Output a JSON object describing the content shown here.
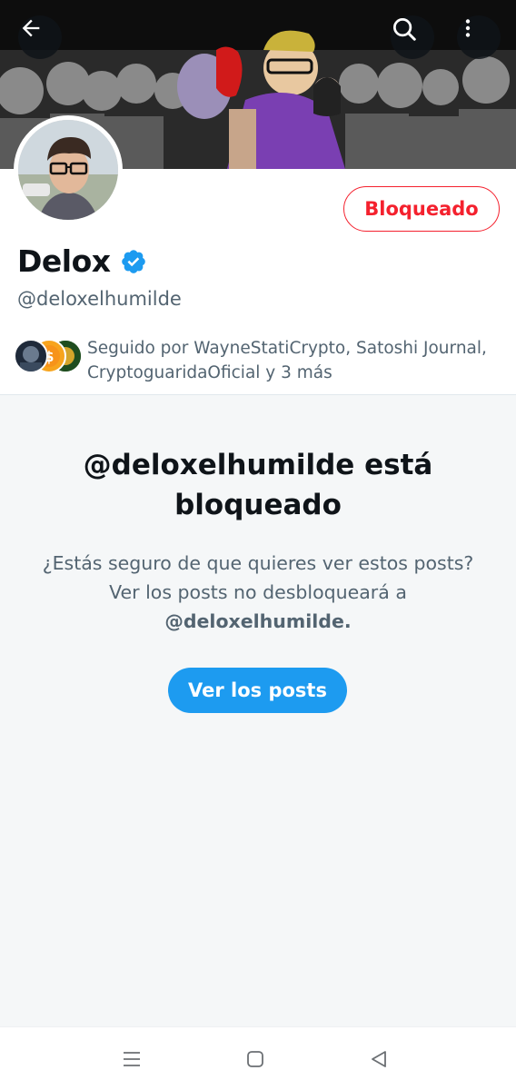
{
  "header": {
    "back_icon": "arrow-left-icon",
    "search_icon": "search-icon",
    "more_icon": "more-vertical-icon"
  },
  "profile": {
    "name": "Delox",
    "handle": "@deloxelhumilde",
    "blocked_button_label": "Bloqueado",
    "followed_by_text": "Seguido por WayneStatiCrypto, Satoshi Journal, CryptoguaridaOficial y 3 más"
  },
  "blocked_notice": {
    "title": "@deloxelhumilde está bloqueado",
    "description_prefix": "¿Estás seguro de que quieres ver estos posts? Ver los posts no desbloqueará a ",
    "description_handle": "@deloxelhumilde.",
    "view_posts_label": "Ver los posts"
  },
  "colors": {
    "accent": "#1d9bf0",
    "blocked_red": "#f4212e",
    "secondary_text": "#536471"
  },
  "system_nav": {
    "menu_icon": "menu-icon",
    "home_icon": "home-square-icon",
    "back_icon": "back-triangle-icon"
  }
}
